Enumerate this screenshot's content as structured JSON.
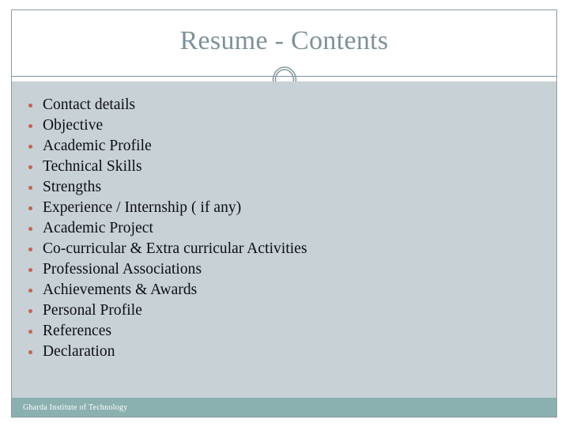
{
  "slide": {
    "title": "Resume - Contents",
    "colors": {
      "title_text": "#7e9298",
      "body_background": "#c7d1d6",
      "header_background": "#ffffff",
      "frame_border": "#8a9ba3",
      "divider_rule": "#7d909a",
      "ornament_stroke": "#8a9ba3",
      "bullet_marker": "#c4654f",
      "list_text": "#0e0e12",
      "footer_background": "#8bb0b0",
      "footer_text": "#ffffff"
    },
    "ornament": {
      "name": "double-ring-circle"
    }
  },
  "contents": {
    "items": [
      {
        "label": "Contact details"
      },
      {
        "label": "Objective"
      },
      {
        "label": "Academic Profile"
      },
      {
        "label": "Technical Skills"
      },
      {
        "label": "Strengths"
      },
      {
        "label": "Experience / Internship ( if any)"
      },
      {
        "label": "Academic Project"
      },
      {
        "label": "Co-curricular & Extra curricular Activities"
      },
      {
        "label": "Professional Associations"
      },
      {
        "label": "Achievements & Awards"
      },
      {
        "label": "Personal Profile"
      },
      {
        "label": "References"
      },
      {
        "label": "Declaration"
      }
    ]
  },
  "footer": {
    "organization": "Gharda Institute of Technology"
  }
}
